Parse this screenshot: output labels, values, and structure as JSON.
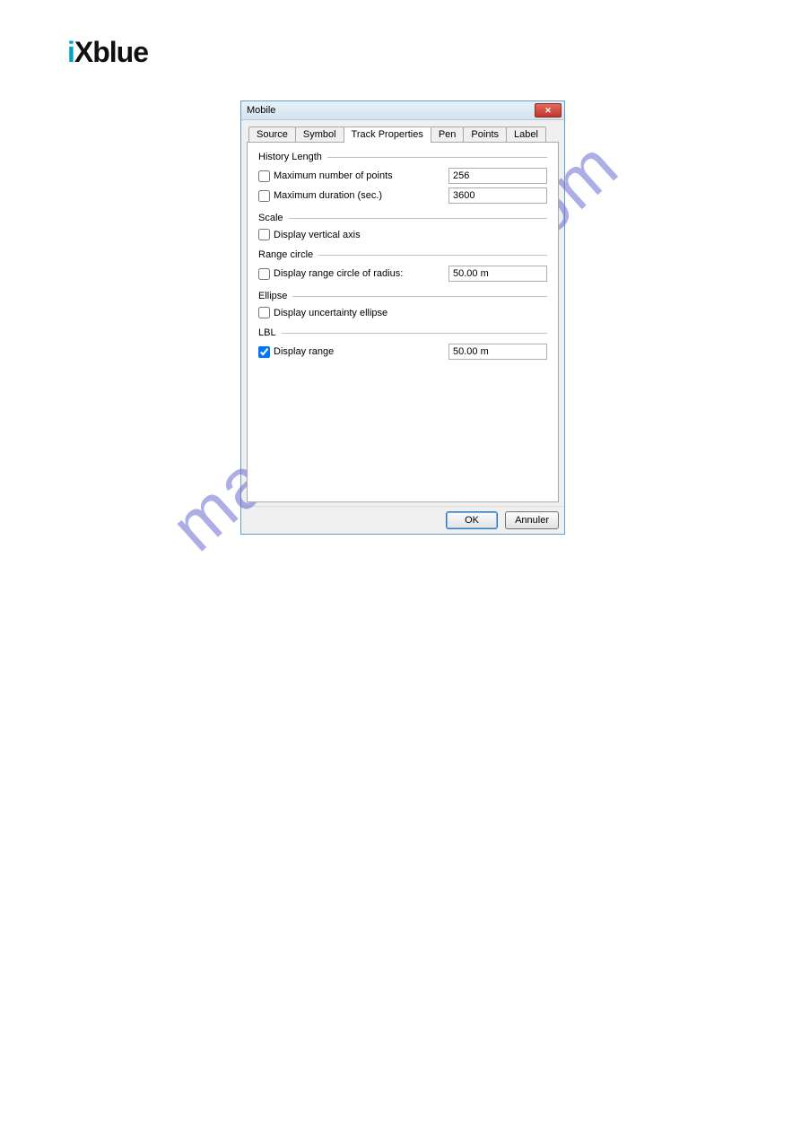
{
  "logo": {
    "prefix": "i",
    "rest": "Xblue"
  },
  "dialog": {
    "title": "Mobile",
    "tabs": [
      "Source",
      "Symbol",
      "Track Properties",
      "Pen",
      "Points",
      "Label"
    ],
    "active_tab": "Track Properties",
    "history": {
      "group_label": "History Length",
      "max_points_label": "Maximum number of points",
      "max_points_value": "256",
      "max_duration_label": "Maximum duration (sec.)",
      "max_duration_value": "3600"
    },
    "scale": {
      "group_label": "Scale",
      "vertical_axis_label": "Display vertical axis"
    },
    "range_circle": {
      "group_label": "Range circle",
      "label": "Display range circle of radius:",
      "value": "50.00 m"
    },
    "ellipse": {
      "group_label": "Ellipse",
      "label": "Display uncertainty ellipse"
    },
    "lbl": {
      "group_label": "LBL",
      "label": "Display range",
      "value": "50.00 m",
      "checked": true
    },
    "buttons": {
      "ok": "OK",
      "cancel": "Annuler"
    }
  },
  "watermark": "manualshive.com"
}
